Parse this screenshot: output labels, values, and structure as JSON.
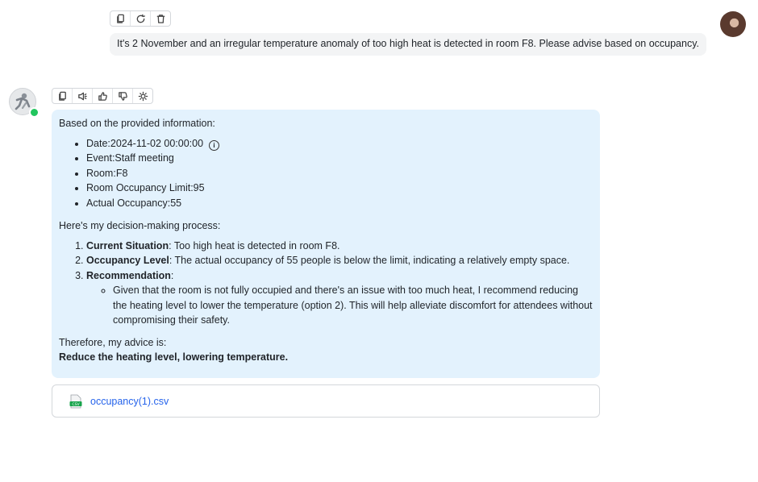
{
  "user_message": {
    "text": "It's 2 November and an irregular temperature anomaly of too high heat is detected in room F8. Please advise based on occupancy.",
    "toolbar": [
      "copy-icon",
      "refresh-icon",
      "trash-icon"
    ]
  },
  "bot_message": {
    "toolbar": [
      "copy-icon",
      "speaker-icon",
      "thumbs-up-icon",
      "thumbs-down-icon",
      "lightbulb-icon"
    ],
    "intro": "Based on the provided information:",
    "facts": [
      "Date:2024-11-02 00:00:00",
      "Event:Staff meeting",
      "Room:F8",
      "Room Occupancy Limit:95",
      "Actual Occupancy:55"
    ],
    "process_intro": "Here's my decision-making process:",
    "steps": [
      {
        "label": "Current Situation",
        "text": ": Too high heat is detected in room F8."
      },
      {
        "label": "Occupancy Level",
        "text": ": The actual occupancy of 55 people is below the limit, indicating a relatively empty space."
      },
      {
        "label": "Recommendation",
        "text": ":"
      }
    ],
    "recommendation_detail": "Given that the room is not fully occupied and there's an issue with too much heat, I recommend reducing the heating level to lower the temperature (option 2). This will help alleviate discomfort for attendees without compromising their safety.",
    "advice_intro": "Therefore, my advice is:",
    "advice": "Reduce the heating level, lowering temperature."
  },
  "attachment": {
    "icon_label": "CSV",
    "filename": "occupancy(1).csv"
  },
  "colors": {
    "bot_bubble": "#e3f2fd",
    "user_bubble": "#f3f4f5",
    "online": "#22c55e",
    "link": "#2563eb"
  }
}
